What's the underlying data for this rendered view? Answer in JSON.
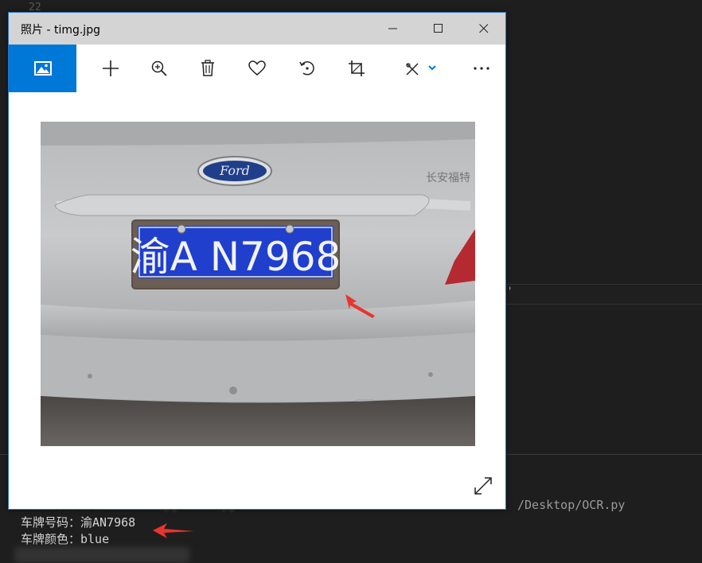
{
  "window": {
    "title": "照片 - timg.jpg"
  },
  "toolbar": {
    "icons": [
      "photos-home-icon",
      "add-icon",
      "zoom-icon",
      "delete-icon",
      "favorite-icon",
      "rotate-icon",
      "crop-icon",
      "edit-draw-icon",
      "chevron-down-icon",
      "more-icon"
    ]
  },
  "photo": {
    "plate_text": "渝A N7968",
    "brand": "Ford"
  },
  "editor": {
    "line_number": "22",
    "snippet": "e'"
  },
  "terminal": {
    "cmd_path": "/Desktop/OCR.py",
    "plate_line": "车牌号码：渝AN7968",
    "color_line": "车牌颜色：blue"
  },
  "colors": {
    "accent": "#0078d7",
    "arrow": "#e8352e",
    "plate_blue": "#1f3fcc"
  }
}
